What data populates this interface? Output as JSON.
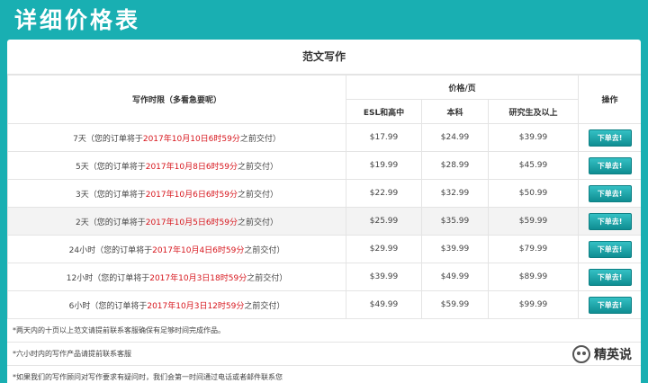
{
  "banner": {
    "title": "详细价格表"
  },
  "section": {
    "title": "范文写作"
  },
  "table": {
    "deadline_header": "写作时限（多看急要呢）",
    "price_header": "价格/页",
    "action_header": "操作",
    "level_headers": [
      "ESL和高中",
      "本科",
      "研究生及以上"
    ],
    "button_label": "下单去!",
    "rows": [
      {
        "deadline": "7天",
        "prefix": "（您的订单将于",
        "date": "2017年10月10日6时59分",
        "suffix": "之前交付）",
        "prices": [
          "$17.99",
          "$24.99",
          "$39.99"
        ]
      },
      {
        "deadline": "5天",
        "prefix": "（您的订单将于",
        "date": "2017年10月8日6时59分",
        "suffix": "之前交付）",
        "prices": [
          "$19.99",
          "$28.99",
          "$45.99"
        ]
      },
      {
        "deadline": "3天",
        "prefix": "（您的订单将于",
        "date": "2017年10月6日6时59分",
        "suffix": "之前交付）",
        "prices": [
          "$22.99",
          "$32.99",
          "$50.99"
        ]
      },
      {
        "deadline": "2天",
        "prefix": "（您的订单将于",
        "date": "2017年10月5日6时59分",
        "suffix": "之前交付）",
        "prices": [
          "$25.99",
          "$35.99",
          "$59.99"
        ]
      },
      {
        "deadline": "24小时",
        "prefix": "（您的订单将于",
        "date": "2017年10月4日6时59分",
        "suffix": "之前交付）",
        "prices": [
          "$29.99",
          "$39.99",
          "$79.99"
        ]
      },
      {
        "deadline": "12小时",
        "prefix": "（您的订单将于",
        "date": "2017年10月3日18时59分",
        "suffix": "之前交付）",
        "prices": [
          "$39.99",
          "$49.99",
          "$89.99"
        ]
      },
      {
        "deadline": "6小时",
        "prefix": "（您的订单将于",
        "date": "2017年10月3日12时59分",
        "suffix": "之前交付）",
        "prices": [
          "$49.99",
          "$59.99",
          "$99.99"
        ]
      }
    ]
  },
  "notes": [
    "*两天内的十页以上范文请提前联系客服确保有足够时间完成作品。",
    "*六小时内的写作产品请提前联系客服",
    "*如果我们的写作顾问对写作要求有疑问时，我们会第一时间通过电话或者邮件联系您"
  ],
  "watermark": {
    "text": "精英说"
  }
}
